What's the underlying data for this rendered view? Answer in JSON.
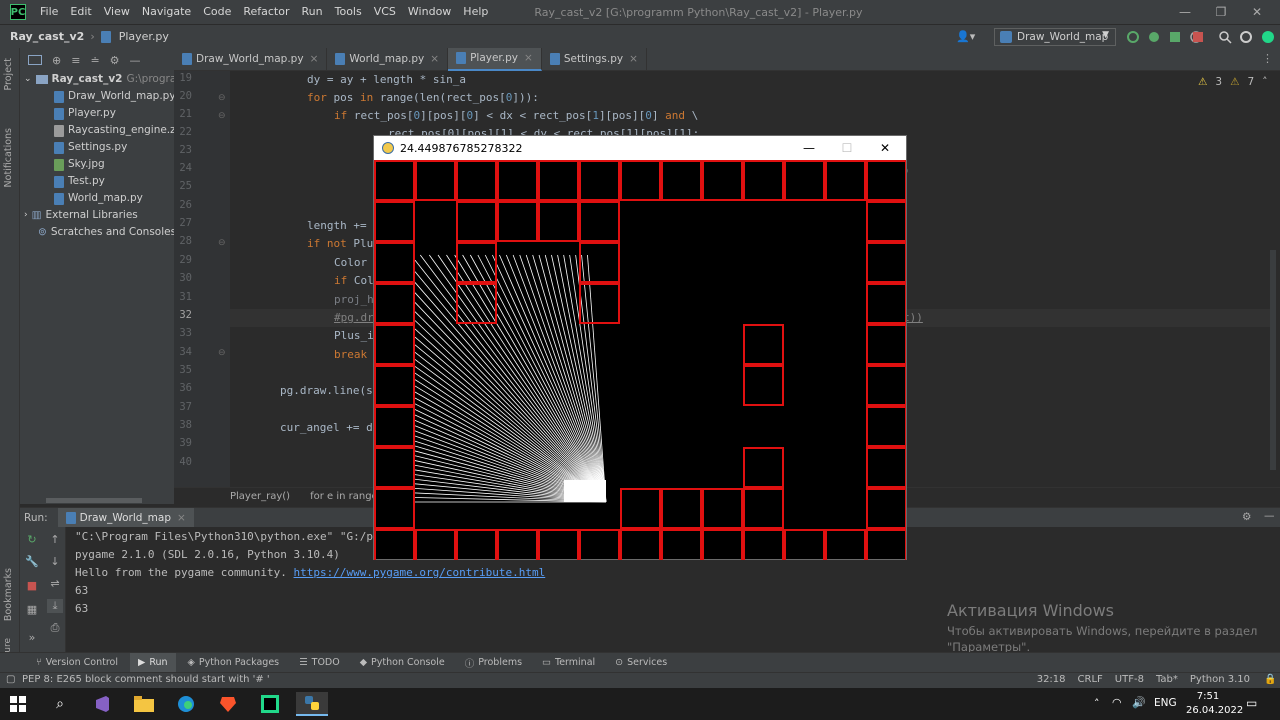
{
  "menu": [
    "File",
    "Edit",
    "View",
    "Navigate",
    "Code",
    "Refactor",
    "Run",
    "Tools",
    "VCS",
    "Window",
    "Help"
  ],
  "window_title": "Ray_cast_v2 [G:\\programm Python\\Ray_cast_v2] - Player.py",
  "breadcrumb": {
    "project": "Ray_cast_v2",
    "file": "Player.py"
  },
  "run_config": "Draw_World_map",
  "side_tabs": {
    "project": "Project",
    "notifications": "Notifications",
    "bookmarks": "Bookmarks",
    "structure": "Structure"
  },
  "project_tree": {
    "root": "Ray_cast_v2",
    "root_path": "G:\\programm",
    "files": [
      "Draw_World_map.py",
      "Player.py",
      "Raycasting_engine.zip",
      "Settings.py",
      "Sky.jpg",
      "Test.py",
      "World_map.py"
    ],
    "external": "External Libraries",
    "scratches": "Scratches and Consoles"
  },
  "tabs": [
    "Draw_World_map.py",
    "World_map.py",
    "Player.py",
    "Settings.py"
  ],
  "warnings": {
    "warn": "3",
    "weak": "7"
  },
  "line_numbers": [
    "19",
    "20",
    "21",
    "22",
    "23",
    "24",
    "25",
    "26",
    "27",
    "28",
    "29",
    "30",
    "31",
    "32",
    "33",
    "34",
    "35",
    "36",
    "37",
    "38",
    "39",
    "40"
  ],
  "code": {
    "l19": "dy = ay + length * sin_a",
    "l20a": "for",
    "l20b": " pos ",
    "l20c": "in",
    "l20d": " range(len(rect_pos[",
    "l20e": "0",
    "l20f": "])):",
    "l21a": "if",
    "l21b": " rect_pos[",
    "l21c": "0",
    "l21d": "][pos][",
    "l21e": "0",
    "l21f": "] < dx < rect_pos[",
    "l21g": "1",
    "l21h": "][pos][",
    "l21i": "0",
    "l21j": "] ",
    "l21k": "and",
    "l21l": " \\",
    "l22": "rect_pos[0][pos][1] < dy < rect_pos[1][pos][1]:",
    "l24": ")",
    "l27": "length +=",
    "l28a": "if not",
    "l28b": " Plu",
    "l29": "Color",
    "l30a": "if",
    "l30b": " Col",
    "l31": "proj_h",
    "l32a": "#pg.dr",
    "l32b": "t))",
    "l33": "Plus_i",
    "l34": "break",
    "l36": "pg.draw.line(s",
    "l38": "cur_angel += d"
  },
  "code_breadcrumb": [
    "Player_ray()",
    "for e in range(R"
  ],
  "run_panel": {
    "label": "Run:",
    "tab": "Draw_World_map"
  },
  "console": [
    "\"C:\\Program Files\\Python310\\python.exe\" \"G:/p",
    "pygame 2.1.0 (SDL 2.0.16, Python 3.10.4)",
    "63",
    "63"
  ],
  "console_hello": "Hello from the pygame community. ",
  "console_link": "https://www.pygame.org/contribute.html",
  "watermark": {
    "title": "Активация Windows",
    "line1": "Чтобы активировать Windows, перейдите в раздел",
    "line2": "\"Параметры\"."
  },
  "tool_tabs": [
    "Version Control",
    "Run",
    "Python Packages",
    "TODO",
    "Python Console",
    "Problems",
    "Terminal",
    "Services"
  ],
  "status": {
    "message": "PEP 8: E265 block comment should start with '# '",
    "position": "32:18",
    "line_sep": "CRLF",
    "encoding": "UTF-8",
    "indent": "Tab*",
    "interpreter": "Python 3.10"
  },
  "tray": {
    "lang": "ENG",
    "time": "7:51",
    "date": "26.04.2022"
  },
  "pygame_window": {
    "title": "24.449876785278322"
  }
}
